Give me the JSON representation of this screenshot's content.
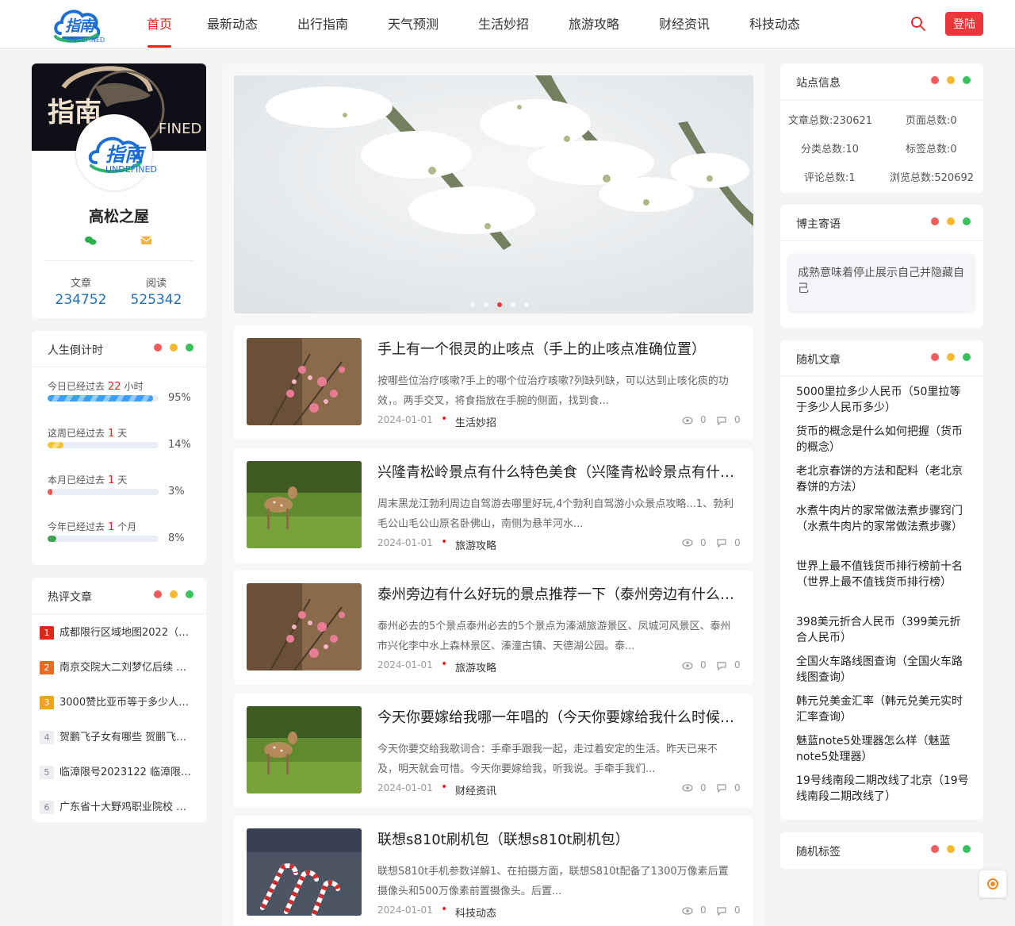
{
  "header": {
    "logo_text": "指南",
    "logo_sub": "UNDEFINED",
    "nav": [
      "首页",
      "最新动态",
      "出行指南",
      "天气预测",
      "生活妙招",
      "旅游攻略",
      "财经资讯",
      "科技动态"
    ],
    "login_label": "登陆",
    "accent": "#e1261c"
  },
  "profile": {
    "banner_title": "指南",
    "banner_sub": "FINED",
    "avatar_text": "指南",
    "avatar_sub": "UNDEFINED",
    "name": "高松之屋",
    "articles_label": "文章",
    "articles_value": "234752",
    "reads_label": "阅读",
    "reads_value": "525342"
  },
  "countdown": {
    "title": "人生倒计时",
    "rows": [
      {
        "prefix": "今日已经过去",
        "num": "22",
        "unit": "小时",
        "pct": "95%",
        "fraction": 0.95
      },
      {
        "prefix": "这周已经过去",
        "num": "1",
        "unit": "天",
        "pct": "14%",
        "fraction": 0.14
      },
      {
        "prefix": "本月已经过去",
        "num": "1",
        "unit": "天",
        "pct": "3%",
        "fraction": 0.03
      },
      {
        "prefix": "今年已经过去",
        "num": "1",
        "unit": "个月",
        "pct": "8%",
        "fraction": 0.08
      }
    ]
  },
  "hot": {
    "title": "热评文章",
    "items": [
      {
        "rank": "1",
        "title": "成都限行区域地图2022（…"
      },
      {
        "rank": "2",
        "title": "南京交院大二刘梦亿后续 …"
      },
      {
        "rank": "3",
        "title": "3000赞比亚币等于多少人…"
      },
      {
        "rank": "4",
        "title": "贺鹏飞子女有哪些 贺鹏飞…"
      },
      {
        "rank": "5",
        "title": "临漳限号2023122 临漳限…"
      },
      {
        "rank": "6",
        "title": "广东省十大野鸡职业院校 …"
      }
    ]
  },
  "articles": [
    {
      "title": "手上有一个很灵的止咳点（手上的止咳点准确位置）",
      "excerpt": "按哪些位治疗咳嗽?手上的哪个位治疗咳嗽?列缺列缺，可以达到止咳化痰的功效，。两手交叉，将食指放在手腕的侧面，找到食...",
      "date": "2024-01-01",
      "category": "生活妙招",
      "views": "0",
      "comments": "0",
      "thumb": "flower"
    },
    {
      "title": "兴隆青松岭景点有什么特色美食（兴隆青松岭景点有什…",
      "excerpt": "周末黑龙江勃利周边自驾游去哪里好玩,4个勃利自驾游小众景点攻略...1、勃利毛公山毛公山原名卧佛山，南侧为悬羊河水...",
      "date": "2024-01-01",
      "category": "旅游攻略",
      "views": "0",
      "comments": "0",
      "thumb": "deer"
    },
    {
      "title": "泰州旁边有什么好玩的景点推荐一下（泰州旁边有什么…",
      "excerpt": "泰州必去的5个景点泰州必去的5个景点为溱湖旅游景区、凤城河风景区、泰州市兴化李中水上森林景区、溱潼古镇、天德湖公园。泰...",
      "date": "2024-01-01",
      "category": "旅游攻略",
      "views": "0",
      "comments": "0",
      "thumb": "flower"
    },
    {
      "title": "今天你要嫁给我哪一年唱的（今天你要嫁给我什么时候…",
      "excerpt": "今天你要交给我歌词合：手牵手跟我一起，走过着安定的生活。昨天已来不及，明天就会可惜。今天你要嫁给我，听我说。手牵手我们...",
      "date": "2024-01-01",
      "category": "财经资讯",
      "views": "0",
      "comments": "0",
      "thumb": "deer"
    },
    {
      "title": "联想s810t刷机包（联想s810t刷机包）",
      "excerpt": "联想S810t手机参数详解1、在拍摄方面，联想S810t配备了1300万像素后置摄像头和500万像素前置摄像头。后置...",
      "date": "2024-01-01",
      "category": "科技动态",
      "views": "0",
      "comments": "0",
      "thumb": "candy"
    }
  ],
  "siteinfo": {
    "title": "站点信息",
    "items": [
      "文章总数:230621",
      "页面总数:0",
      "分类总数:10",
      "标签总数:0",
      "评论总数:1",
      "浏览总数:520692"
    ]
  },
  "motto": {
    "title": "博主寄语",
    "text": "成熟意味着停止展示自己并隐藏自己"
  },
  "random": {
    "title": "随机文章",
    "items": [
      "5000里拉多少人民币（50里拉等于多少人民币多少）",
      "货币的概念是什么如何把握（货币的概念）",
      "老北京春饼的方法和配料（老北京春饼的方法）",
      "水煮牛肉片的家常做法煮步骤窍门（水煮牛肉片的家常做法煮步骤）",
      "世界上最不值钱货币排行榜前十名（世界上最不值钱货币排行榜）",
      "398美元折合人民币（399美元折合人民币）",
      "全国火车路线图查询（全国火车路线图查询）",
      "韩元兑美金汇率（韩元兑美元实时汇率查询）",
      "魅蓝note5处理器怎么样（魅蓝note5处理器）",
      "19号线南段二期改线了北京（19号线南段二期改线了）"
    ]
  },
  "tags": {
    "title": "随机标签"
  }
}
